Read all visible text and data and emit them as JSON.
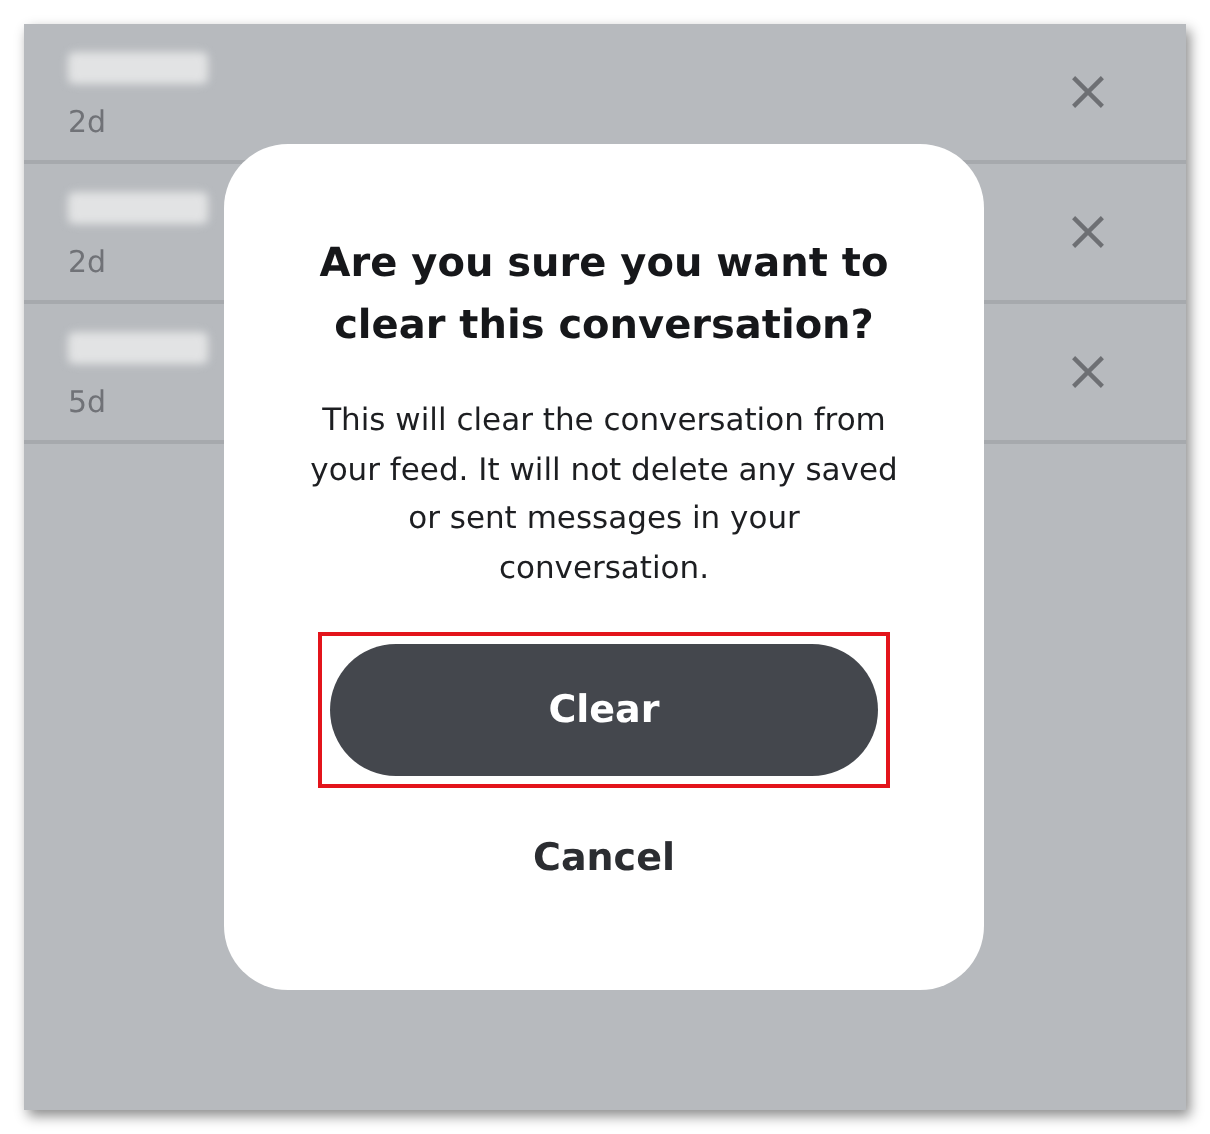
{
  "conversations": [
    {
      "time": "2d"
    },
    {
      "time": "2d"
    },
    {
      "time": "5d"
    }
  ],
  "dialog": {
    "title": "Are you sure you want to clear this conversation?",
    "message": "This will clear the conversation from your feed. It will not delete any saved or sent messages in your conversation.",
    "confirm": {
      "label": "Clear",
      "highlighted": true
    },
    "cancel": "Cancel"
  }
}
